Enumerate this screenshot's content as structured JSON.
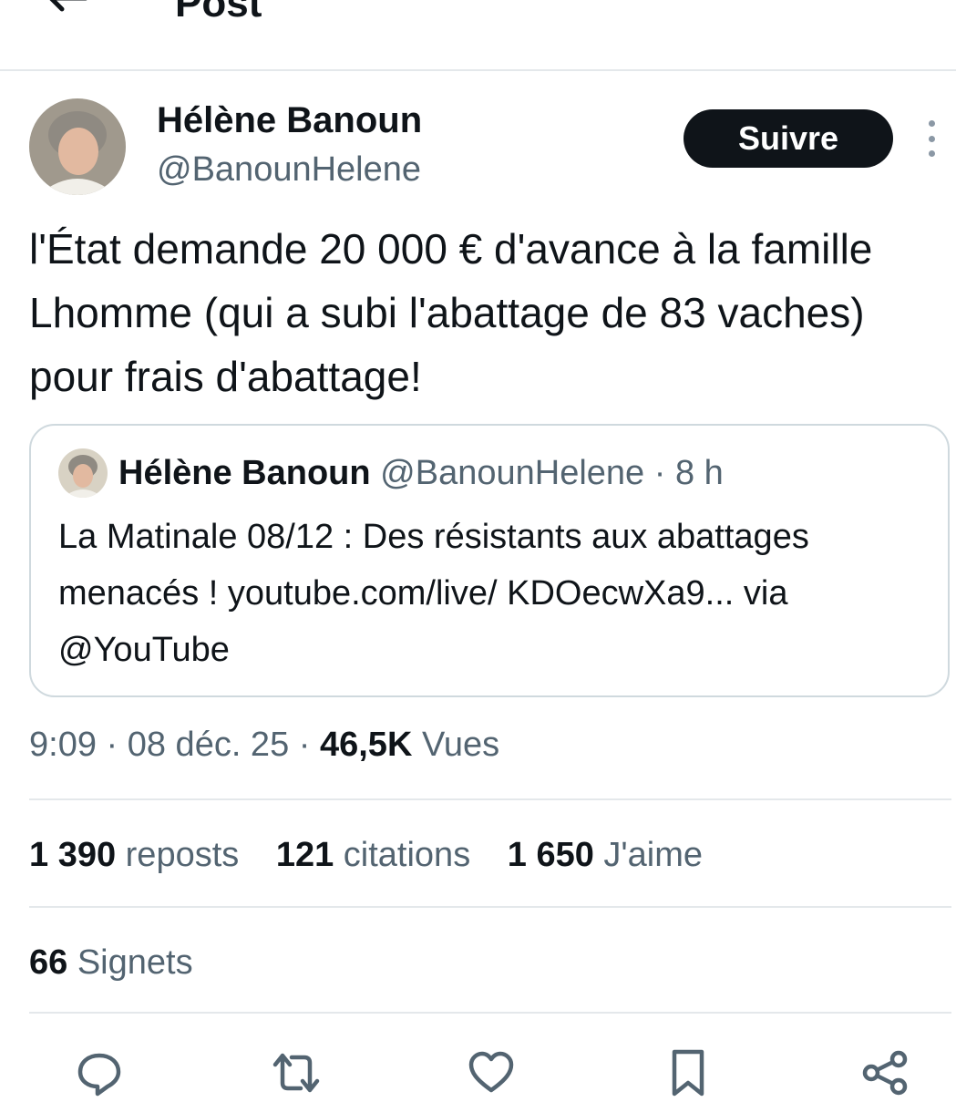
{
  "header": {
    "title": "Post",
    "back_icon": "arrow-left-icon"
  },
  "author": {
    "name": "Hélène Banoun",
    "handle": "@BanounHelene",
    "follow_label": "Suivre"
  },
  "tweet": {
    "text": "l'État demande 20 000 € d'avance à la famille Lhomme (qui a subi l'abattage de 83 vaches) pour frais d'abattage!"
  },
  "quote": {
    "name": "Hélène Banoun",
    "handle_time": "@BanounHelene · 8 h",
    "text": "La Matinale 08/12 : Des résistants aux abattages menacés ! youtube.com/live/ KDOecwXa9... via @YouTube"
  },
  "meta": {
    "time_date": "9:09 · 08 déc. 25 · ",
    "views_count": "46,5K",
    "views_label": " Vues"
  },
  "stats": {
    "reposts_count": "1 390",
    "reposts_label": " reposts",
    "quotes_count": "121",
    "quotes_label": " citations",
    "likes_count": "1 650",
    "likes_label": " J'aime",
    "bookmarks_count": "66",
    "bookmarks_label": " Signets"
  },
  "actions": [
    "reply-icon",
    "repost-icon",
    "like-icon",
    "bookmark-icon",
    "share-icon"
  ],
  "colors": {
    "text": "#0f1419",
    "secondary": "#536471",
    "divider": "#e4e8eb",
    "button_bg": "#0f1419"
  }
}
